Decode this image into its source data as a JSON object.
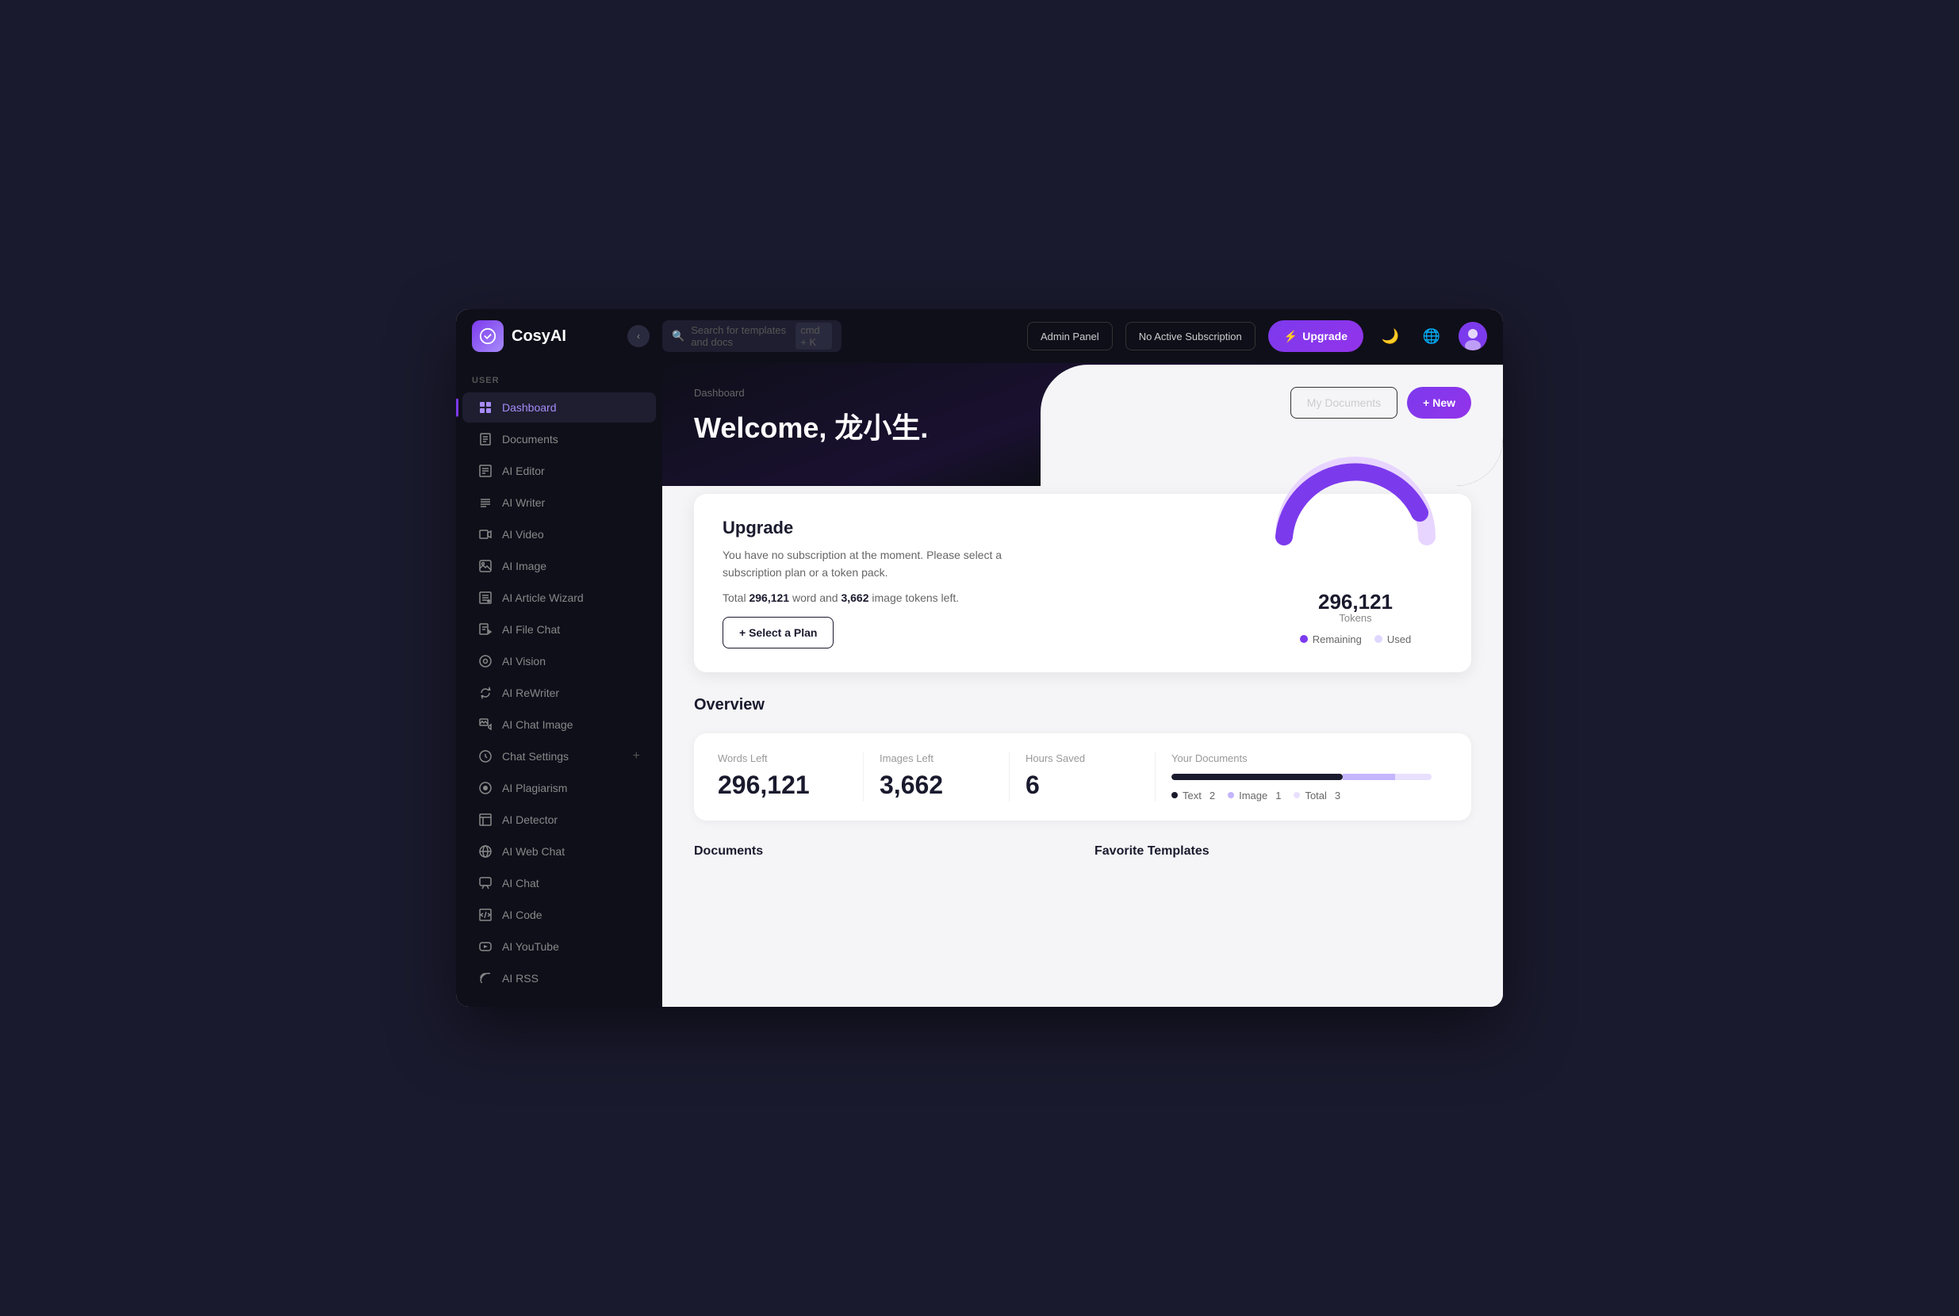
{
  "app": {
    "name": "CosyAI"
  },
  "topbar": {
    "search_placeholder": "Search for templates and docs",
    "search_kbd": "cmd + K",
    "admin_panel_label": "Admin Panel",
    "subscription_label": "No Active Subscription",
    "upgrade_label": "Upgrade"
  },
  "sidebar": {
    "section_label": "USER",
    "items": [
      {
        "id": "dashboard",
        "label": "Dashboard",
        "icon": "⊞",
        "active": true
      },
      {
        "id": "documents",
        "label": "Documents",
        "icon": "☰",
        "active": false
      },
      {
        "id": "ai-editor",
        "label": "AI Editor",
        "icon": "▦",
        "active": false
      },
      {
        "id": "ai-writer",
        "label": "AI Writer",
        "icon": "≡",
        "active": false
      },
      {
        "id": "ai-video",
        "label": "AI Video",
        "icon": "⬛",
        "active": false
      },
      {
        "id": "ai-image",
        "label": "AI Image",
        "icon": "⬜",
        "active": false
      },
      {
        "id": "ai-article-wizard",
        "label": "AI Article Wizard",
        "icon": "▤",
        "active": false
      },
      {
        "id": "ai-file-chat",
        "label": "AI File Chat",
        "icon": "◫",
        "active": false
      },
      {
        "id": "ai-vision",
        "label": "AI Vision",
        "icon": "◎",
        "active": false
      },
      {
        "id": "ai-rewriter",
        "label": "AI ReWriter",
        "icon": "✏",
        "active": false
      },
      {
        "id": "ai-chat-image",
        "label": "AI Chat Image",
        "icon": "▨",
        "active": false
      },
      {
        "id": "chat-settings",
        "label": "Chat Settings",
        "icon": "◯",
        "active": false,
        "has_plus": true
      },
      {
        "id": "ai-plagiarism",
        "label": "AI Plagiarism",
        "icon": "◉",
        "active": false
      },
      {
        "id": "ai-detector",
        "label": "AI Detector",
        "icon": "▣",
        "active": false
      },
      {
        "id": "ai-web-chat",
        "label": "AI Web Chat",
        "icon": "⊕",
        "active": false
      },
      {
        "id": "ai-chat",
        "label": "AI Chat",
        "icon": "◻",
        "active": false
      },
      {
        "id": "ai-code",
        "label": "AI Code",
        "icon": "▷",
        "active": false
      },
      {
        "id": "ai-youtube",
        "label": "AI YouTube",
        "icon": "▶",
        "active": false
      },
      {
        "id": "ai-rss",
        "label": "AI RSS",
        "icon": "◑",
        "active": false
      }
    ]
  },
  "hero": {
    "breadcrumb": "Dashboard",
    "title": "Welcome, 龙小生.",
    "my_documents_label": "My Documents",
    "new_label": "+ New"
  },
  "upgrade_card": {
    "title": "Upgrade",
    "description": "You have no subscription at the moment. Please select a subscription plan or a token pack.",
    "tokens_text_prefix": "Total",
    "word_count": "296,121",
    "word_label": "word and",
    "image_count": "3,662",
    "image_label": "image tokens left.",
    "select_plan_label": "+ Select a Plan",
    "donut": {
      "value": "296,121",
      "unit": "Tokens",
      "remaining_label": "Remaining",
      "used_label": "Used",
      "remaining_color": "#7c3aed",
      "used_color": "#e0d7ff",
      "remaining_percent": 95,
      "used_percent": 5
    }
  },
  "overview": {
    "section_title": "Overview",
    "words_left_label": "Words Left",
    "words_left_value": "296,121",
    "images_left_label": "Images Left",
    "images_left_value": "3,662",
    "hours_saved_label": "Hours Saved",
    "hours_saved_value": "6",
    "your_docs_label": "Your Documents",
    "docs_legend": [
      {
        "label": "Text",
        "count": "2",
        "color": "#1a1a2e"
      },
      {
        "label": "Image",
        "count": "1",
        "color": "#c4b5fd"
      },
      {
        "label": "Total",
        "count": "3",
        "color": "#e8e0ff"
      }
    ]
  },
  "bottom": {
    "documents_title": "Documents",
    "favorite_templates_title": "Favorite Templates"
  }
}
